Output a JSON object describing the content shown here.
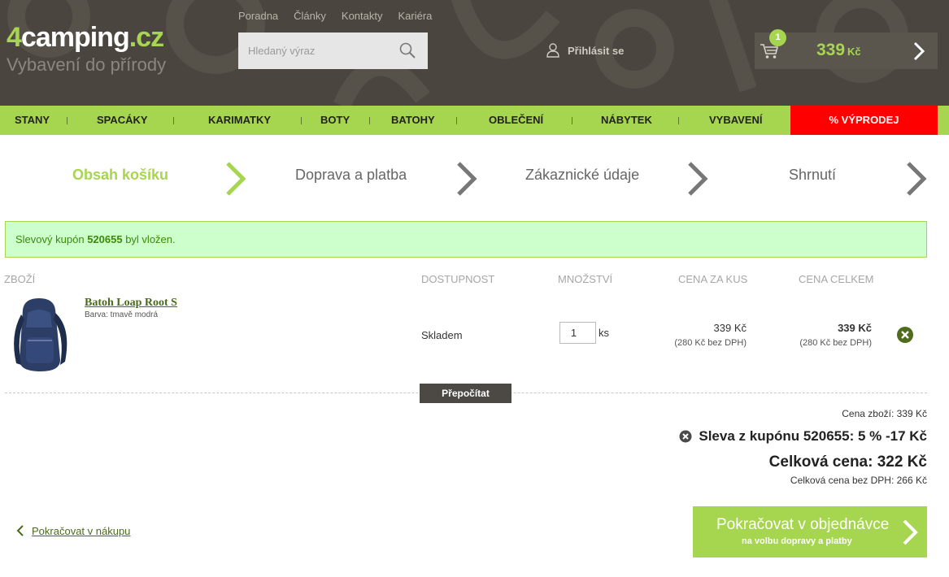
{
  "header": {
    "logo_4": "4",
    "logo_text": "camping",
    "logo_tld": ".cz",
    "logo_tagline": "Vybavení do přírody",
    "top_links": [
      "Poradna",
      "Články",
      "Kontakty",
      "Kariéra"
    ],
    "search_placeholder": "Hledaný výraz",
    "login_label": "Přihlásit se",
    "cart_count": "1",
    "cart_price": "339",
    "cart_currency": "Kč"
  },
  "nav": {
    "items": [
      "STANY",
      "SPACÁKY",
      "KARIMATKY",
      "BOTY",
      "BATOHY",
      "OBLEČENÍ",
      "NÁBYTEK",
      "VYBAVENÍ"
    ],
    "sale": "% VÝPRODEJ"
  },
  "steps": [
    "Obsah košíku",
    "Doprava a platba",
    "Zákaznické údaje",
    "Shrnutí"
  ],
  "coupon_message": {
    "prefix": "Slevový kupón",
    "code": "520655",
    "suffix": "byl vložen."
  },
  "table": {
    "headers": [
      "ZBOŽÍ",
      "DOSTUPNOST",
      "MNOŽSTVÍ",
      "CENA ZA KUS",
      "CENA CELKEM"
    ],
    "item": {
      "name": "Batoh Loap Root S",
      "color": "Barva: tmavě modrá",
      "availability": "Skladem",
      "quantity": "1",
      "unit": "ks",
      "unit_price": "339 Kč",
      "unit_price_novat": "(280 Kč bez DPH)",
      "total_price": "339 Kč",
      "total_price_novat": "(280 Kč bez DPH)"
    }
  },
  "recalc_label": "Přepočítat",
  "totals": {
    "goods": "Cena zboží: 339 Kč",
    "discount": "Sleva z kupónu 520655: 5 % -17 Kč",
    "total": "Celková cena: 322 Kč",
    "total_novat": "Celková cena bez DPH: 266 Kč"
  },
  "actions": {
    "continue_shopping": "Pokračovat v nákupu",
    "next_main": "Pokračovat v objednávce",
    "next_sub": "na volbu dopravy a platby"
  },
  "colors": {
    "accent": "#a6d64f",
    "sale": "#ff0000",
    "header_bg": "#4a463f"
  }
}
